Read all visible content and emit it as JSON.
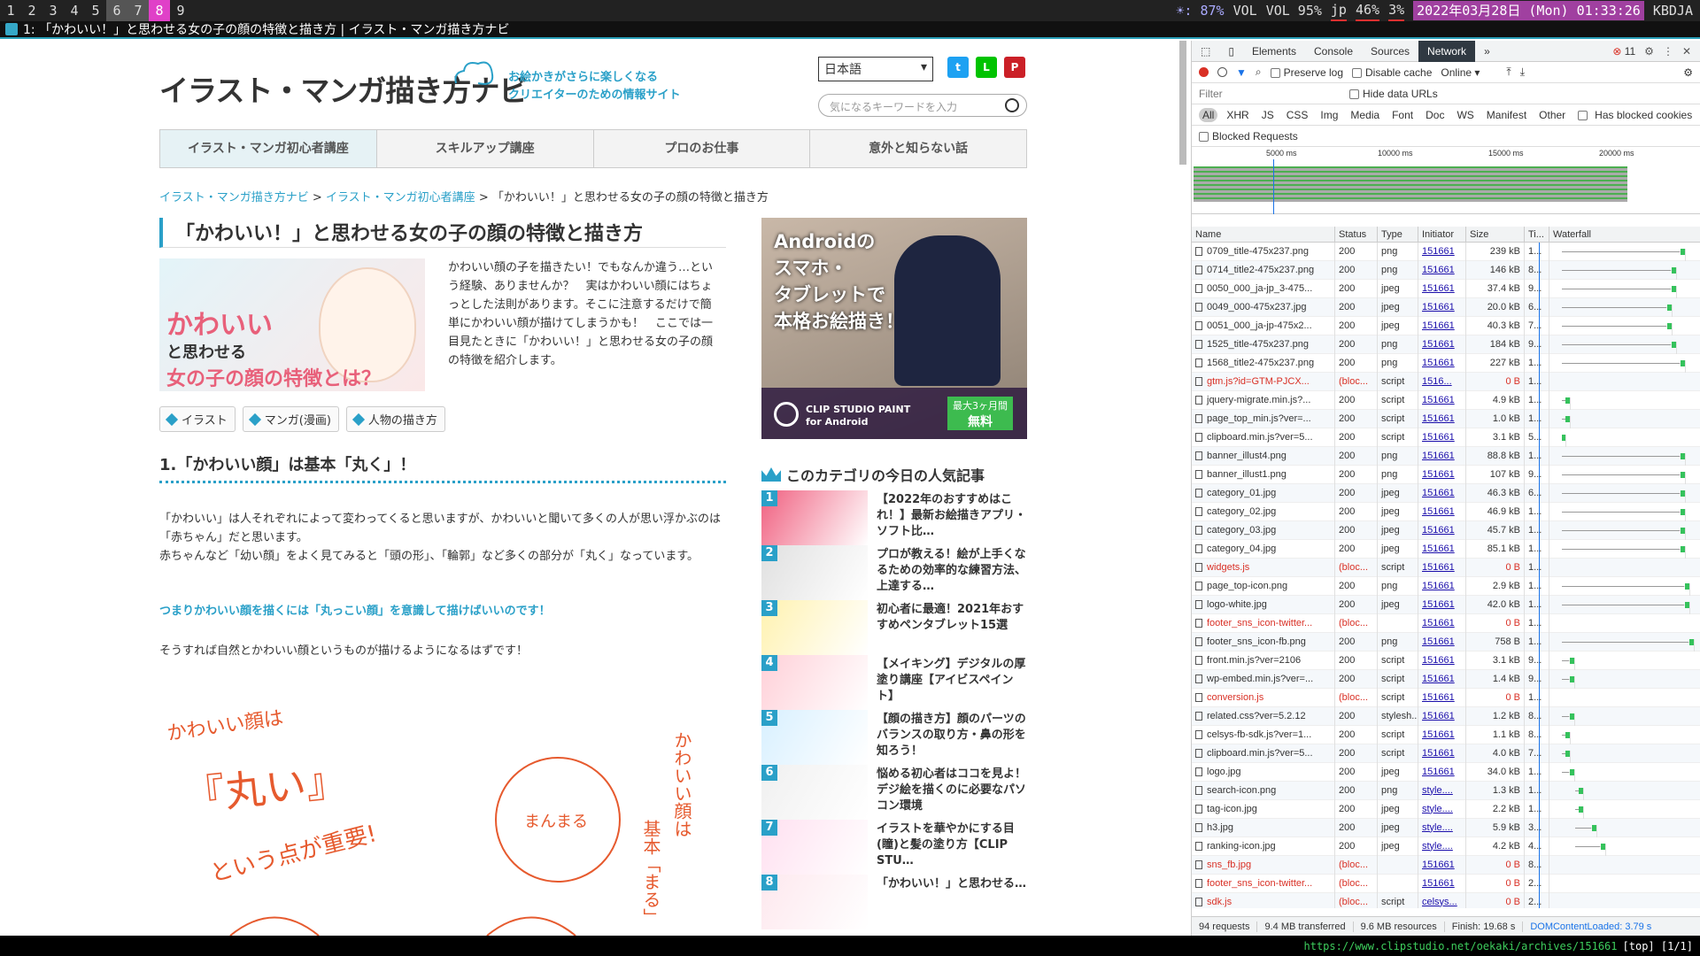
{
  "topbar": {
    "workspaces": [
      "1",
      "2",
      "3",
      "4",
      "5",
      "6",
      "7",
      "8",
      "9"
    ],
    "brightness": "☀: 87%",
    "vol_label": "VOL",
    "vol": "VOL 95%",
    "lang": "jp",
    "cpu": "46%",
    "mem": "3%",
    "datetime": "2022年03月28日 (Mon) 01:33:26",
    "host": "KBDJA"
  },
  "titlebar": {
    "title": "1: 「かわいい！」と思わせる女の子の顔の特徴と描き方 | イラスト・マンガ描き方ナビ"
  },
  "site": {
    "logo": "イラスト・マンガ描き方ナビ",
    "tagline1": "お絵かきがさらに楽しくなる",
    "tagline2": "クリエイターのための情報サイト",
    "lang_select": "日本語",
    "search_placeholder": "気になるキーワードを入力",
    "nav": [
      "イラスト・マンガ初心者講座",
      "スキルアップ講座",
      "プロのお仕事",
      "意外と知らない話"
    ],
    "breadcrumb": [
      "イラスト・マンガ描き方ナビ",
      "イラスト・マンガ初心者講座",
      "「かわいい！」と思わせる女の子の顔の特徴と描き方"
    ],
    "crumb_sep": ">",
    "h1": "「かわいい！」と思わせる女の子の顔の特徴と描き方",
    "hero": {
      "t1": "かわいい",
      "t2": "と思わせる",
      "t3": "女の子の顔の特徴とは？"
    },
    "intro": "かわいい顔の子を描きたい！でもなんか違う…という経験、ありませんか？　実はかわいい顔にはちょっとした法則があります。そこに注意するだけで簡単にかわいい顔が描けてしまうかも！　ここでは一目見たときに「かわいい！」と思わせる女の子の顔の特徴を紹介します。",
    "tags": [
      "イラスト",
      "マンガ(漫画)",
      "人物の描き方"
    ],
    "h2": "1.「かわいい顔」は基本「丸く」！",
    "body1a": "「かわいい」は人それぞれによって変わってくると思いますが、かわいいと聞いて多くの人が思い浮かぶのは「赤ちゃん」だと思います。",
    "body1b": "赤ちゃんなど「幼い顔」をよく見てみると「頭の形」、「輪郭」など多くの部分が「丸く」なっています。",
    "highlight": "つまりかわいい顔を描くには「丸っこい顔」を意識して描けばいいのです！",
    "body2": "そうすれば自然とかわいい顔というものが描けるようになるはずです！",
    "drawing": {
      "a1": "かわいい顔は",
      "a2": "『丸い』",
      "a3": "という点が重要!",
      "a4": "まんまる",
      "a5": "かわいい顔は",
      "a6": "基本「まる」"
    },
    "ad": {
      "l1": "Androidの",
      "l2": "スマホ・",
      "l3": "タブレットで",
      "l4": "本格お絵描き！",
      "clip": "CLIP STUDIO PAINT for Android",
      "free1": "最大3ヶ月間",
      "free2": "無料"
    },
    "rank_title": "このカテゴリの今日の人気記事",
    "rank": [
      {
        "n": "1",
        "t": "【2022年のおすすめはこれ！】最新お絵描きアプリ・ソフト比…"
      },
      {
        "n": "2",
        "t": "プロが教える！絵が上手くなるための効率的な練習方法、上達する…"
      },
      {
        "n": "3",
        "t": "初心者に最適！2021年おすすめペンタブレット15選"
      },
      {
        "n": "4",
        "t": "【メイキング】デジタルの厚塗り講座【アイビスペイント】"
      },
      {
        "n": "5",
        "t": "【顔の描き方】顔のパーツのバランスの取り方・鼻の形を知ろう！"
      },
      {
        "n": "6",
        "t": "悩める初心者はココを見よ！デジ絵を描くのに必要なパソコン環境"
      },
      {
        "n": "7",
        "t": "イラストを華やかにする目(瞳)と髪の塗り方【CLIP STU…"
      },
      {
        "n": "8",
        "t": "「かわいい！」と思わせる…"
      }
    ]
  },
  "devtools": {
    "tabs": [
      "Elements",
      "Console",
      "Sources",
      "Network"
    ],
    "active_tab": "Network",
    "more": "»",
    "errors": "11",
    "preserve_log": "Preserve log",
    "disable_cache": "Disable cache",
    "throttle": "Online",
    "filter_placeholder": "Filter",
    "hide_data_urls": "Hide data URLs",
    "types": [
      "All",
      "XHR",
      "JS",
      "CSS",
      "Img",
      "Media",
      "Font",
      "Doc",
      "WS",
      "Manifest",
      "Other"
    ],
    "has_blocked_cookies": "Has blocked cookies",
    "blocked_requests": "Blocked Requests",
    "overview_ticks": [
      "5000 ms",
      "10000 ms",
      "15000 ms",
      "20000 ms"
    ],
    "columns": [
      "Name",
      "Status",
      "Type",
      "Initiator",
      "Size",
      "Ti...",
      "Waterfall"
    ],
    "requests": [
      {
        "name": "0709_title-475x237.png",
        "status": "200",
        "type": "png",
        "init": "151661",
        "size": "239 kB",
        "time": "1...",
        "ws": 0.02,
        "we": 0.3,
        "red": false
      },
      {
        "name": "0714_title2-475x237.png",
        "status": "200",
        "type": "png",
        "init": "151661",
        "size": "146 kB",
        "time": "8...",
        "ws": 0.02,
        "we": 0.28,
        "red": false
      },
      {
        "name": "0050_000_ja-jp_3-475...",
        "status": "200",
        "type": "jpeg",
        "init": "151661",
        "size": "37.4 kB",
        "time": "9...",
        "ws": 0.02,
        "we": 0.28,
        "red": false
      },
      {
        "name": "0049_000-475x237.jpg",
        "status": "200",
        "type": "jpeg",
        "init": "151661",
        "size": "20.0 kB",
        "time": "6...",
        "ws": 0.02,
        "we": 0.27,
        "red": false
      },
      {
        "name": "0051_000_ja-jp-475x2...",
        "status": "200",
        "type": "jpeg",
        "init": "151661",
        "size": "40.3 kB",
        "time": "7...",
        "ws": 0.02,
        "we": 0.27,
        "red": false
      },
      {
        "name": "1525_title-475x237.png",
        "status": "200",
        "type": "png",
        "init": "151661",
        "size": "184 kB",
        "time": "9...",
        "ws": 0.02,
        "we": 0.28,
        "red": false
      },
      {
        "name": "1568_title2-475x237.png",
        "status": "200",
        "type": "png",
        "init": "151661",
        "size": "227 kB",
        "time": "1...",
        "ws": 0.02,
        "we": 0.3,
        "red": false
      },
      {
        "name": "gtm.js?id=GTM-PJCX...",
        "status": "(bloc...",
        "type": "script",
        "init": "1516...",
        "size": "0 B",
        "time": "1...",
        "ws": 0,
        "we": 0,
        "red": true
      },
      {
        "name": "jquery-migrate.min.js?...",
        "status": "200",
        "type": "script",
        "init": "151661",
        "size": "4.9 kB",
        "time": "1...",
        "ws": 0.02,
        "we": 0.04,
        "red": false
      },
      {
        "name": "page_top_min.js?ver=...",
        "status": "200",
        "type": "script",
        "init": "151661",
        "size": "1.0 kB",
        "time": "1...",
        "ws": 0.02,
        "we": 0.04,
        "red": false
      },
      {
        "name": "clipboard.min.js?ver=5...",
        "status": "200",
        "type": "script",
        "init": "151661",
        "size": "3.1 kB",
        "time": "5...",
        "ws": 0.02,
        "we": 0.03,
        "red": false
      },
      {
        "name": "banner_illust4.png",
        "status": "200",
        "type": "png",
        "init": "151661",
        "size": "88.8 kB",
        "time": "1...",
        "ws": 0.02,
        "we": 0.3,
        "red": false
      },
      {
        "name": "banner_illust1.png",
        "status": "200",
        "type": "png",
        "init": "151661",
        "size": "107 kB",
        "time": "9...",
        "ws": 0.02,
        "we": 0.3,
        "red": false
      },
      {
        "name": "category_01.jpg",
        "status": "200",
        "type": "jpeg",
        "init": "151661",
        "size": "46.3 kB",
        "time": "6...",
        "ws": 0.02,
        "we": 0.3,
        "red": false
      },
      {
        "name": "category_02.jpg",
        "status": "200",
        "type": "jpeg",
        "init": "151661",
        "size": "46.9 kB",
        "time": "1...",
        "ws": 0.02,
        "we": 0.3,
        "red": false
      },
      {
        "name": "category_03.jpg",
        "status": "200",
        "type": "jpeg",
        "init": "151661",
        "size": "45.7 kB",
        "time": "1...",
        "ws": 0.02,
        "we": 0.3,
        "red": false
      },
      {
        "name": "category_04.jpg",
        "status": "200",
        "type": "jpeg",
        "init": "151661",
        "size": "85.1 kB",
        "time": "1...",
        "ws": 0.02,
        "we": 0.3,
        "red": false
      },
      {
        "name": "widgets.js",
        "status": "(bloc...",
        "type": "script",
        "init": "151661",
        "size": "0 B",
        "time": "1...",
        "ws": 0,
        "we": 0,
        "red": true
      },
      {
        "name": "page_top-icon.png",
        "status": "200",
        "type": "png",
        "init": "151661",
        "size": "2.9 kB",
        "time": "1...",
        "ws": 0.02,
        "we": 0.31,
        "red": false
      },
      {
        "name": "logo-white.jpg",
        "status": "200",
        "type": "jpeg",
        "init": "151661",
        "size": "42.0 kB",
        "time": "1...",
        "ws": 0.02,
        "we": 0.31,
        "red": false
      },
      {
        "name": "footer_sns_icon-twitter...",
        "status": "(bloc...",
        "type": "",
        "init": "151661",
        "size": "0 B",
        "time": "1...",
        "ws": 0,
        "we": 0,
        "red": true
      },
      {
        "name": "footer_sns_icon-fb.png",
        "status": "200",
        "type": "png",
        "init": "151661",
        "size": "758 B",
        "time": "1...",
        "ws": 0.02,
        "we": 0.32,
        "red": false
      },
      {
        "name": "front.min.js?ver=2106",
        "status": "200",
        "type": "script",
        "init": "151661",
        "size": "3.1 kB",
        "time": "9...",
        "ws": 0.02,
        "we": 0.05,
        "red": false
      },
      {
        "name": "wp-embed.min.js?ver=...",
        "status": "200",
        "type": "script",
        "init": "151661",
        "size": "1.4 kB",
        "time": "9...",
        "ws": 0.02,
        "we": 0.05,
        "red": false
      },
      {
        "name": "conversion.js",
        "status": "(bloc...",
        "type": "script",
        "init": "151661",
        "size": "0 B",
        "time": "1...",
        "ws": 0,
        "we": 0,
        "red": true
      },
      {
        "name": "related.css?ver=5.2.12",
        "status": "200",
        "type": "stylesh...",
        "init": "151661",
        "size": "1.2 kB",
        "time": "8...",
        "ws": 0.02,
        "we": 0.05,
        "red": false
      },
      {
        "name": "celsys-fb-sdk.js?ver=1...",
        "status": "200",
        "type": "script",
        "init": "151661",
        "size": "1.1 kB",
        "time": "8...",
        "ws": 0.02,
        "we": 0.04,
        "red": false
      },
      {
        "name": "clipboard.min.js?ver=5...",
        "status": "200",
        "type": "script",
        "init": "151661",
        "size": "4.0 kB",
        "time": "7...",
        "ws": 0.02,
        "we": 0.04,
        "red": false
      },
      {
        "name": "logo.jpg",
        "status": "200",
        "type": "jpeg",
        "init": "151661",
        "size": "34.0 kB",
        "time": "1...",
        "ws": 0.02,
        "we": 0.05,
        "red": false
      },
      {
        "name": "search-icon.png",
        "status": "200",
        "type": "png",
        "init": "style....",
        "size": "1.3 kB",
        "time": "1...",
        "ws": 0.05,
        "we": 0.07,
        "red": false
      },
      {
        "name": "tag-icon.jpg",
        "status": "200",
        "type": "jpeg",
        "init": "style....",
        "size": "2.2 kB",
        "time": "1...",
        "ws": 0.05,
        "we": 0.07,
        "red": false
      },
      {
        "name": "h3.jpg",
        "status": "200",
        "type": "jpeg",
        "init": "style....",
        "size": "5.9 kB",
        "time": "3...",
        "ws": 0.05,
        "we": 0.1,
        "red": false
      },
      {
        "name": "ranking-icon.jpg",
        "status": "200",
        "type": "jpeg",
        "init": "style....",
        "size": "4.2 kB",
        "time": "4...",
        "ws": 0.05,
        "we": 0.12,
        "red": false
      },
      {
        "name": "sns_fb.jpg",
        "status": "(bloc...",
        "type": "",
        "init": "151661",
        "size": "0 B",
        "time": "8...",
        "ws": 0,
        "we": 0,
        "red": true
      },
      {
        "name": "footer_sns_icon-twitter...",
        "status": "(bloc...",
        "type": "",
        "init": "151661",
        "size": "0 B",
        "time": "2...",
        "ws": 0,
        "we": 0,
        "red": true
      },
      {
        "name": "sdk.js",
        "status": "(bloc...",
        "type": "script",
        "init": "celsys...",
        "size": "0 B",
        "time": "2...",
        "ws": 0,
        "we": 0,
        "red": true
      }
    ],
    "status": {
      "requests": "94 requests",
      "transferred": "9.4 MB transferred",
      "resources": "9.6 MB resources",
      "finish": "Finish: 19.68 s",
      "dcl": "DOMContentLoaded: 3.79 s"
    }
  },
  "statusline": {
    "url": "https://www.clipstudio.net/oekaki/archives/151661",
    "frame": "[top] [1/1]"
  }
}
